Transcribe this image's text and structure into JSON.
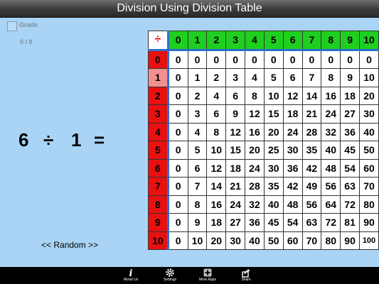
{
  "app": {
    "title": "Division Using Division Table"
  },
  "grade": {
    "label": "Grade",
    "score": "0 / 0"
  },
  "equation": {
    "dividend": "6",
    "operator": "÷",
    "divisor": "1",
    "equals": "="
  },
  "random": {
    "label": "<< Random >>"
  },
  "table": {
    "symbol": "÷",
    "headers": [
      "0",
      "1",
      "2",
      "3",
      "4",
      "5",
      "6",
      "7",
      "8",
      "9",
      "10"
    ],
    "selected_row": 1,
    "rows": [
      {
        "label": "0",
        "cells": [
          "0",
          "0",
          "0",
          "0",
          "0",
          "0",
          "0",
          "0",
          "0",
          "0",
          "0"
        ]
      },
      {
        "label": "1",
        "cells": [
          "0",
          "1",
          "2",
          "3",
          "4",
          "5",
          "6",
          "7",
          "8",
          "9",
          "10"
        ]
      },
      {
        "label": "2",
        "cells": [
          "0",
          "2",
          "4",
          "6",
          "8",
          "10",
          "12",
          "14",
          "16",
          "18",
          "20"
        ]
      },
      {
        "label": "3",
        "cells": [
          "0",
          "3",
          "6",
          "9",
          "12",
          "15",
          "18",
          "21",
          "24",
          "27",
          "30"
        ]
      },
      {
        "label": "4",
        "cells": [
          "0",
          "4",
          "8",
          "12",
          "16",
          "20",
          "24",
          "28",
          "32",
          "36",
          "40"
        ]
      },
      {
        "label": "5",
        "cells": [
          "0",
          "5",
          "10",
          "15",
          "20",
          "25",
          "30",
          "35",
          "40",
          "45",
          "50"
        ]
      },
      {
        "label": "6",
        "cells": [
          "0",
          "6",
          "12",
          "18",
          "24",
          "30",
          "36",
          "42",
          "48",
          "54",
          "60"
        ]
      },
      {
        "label": "7",
        "cells": [
          "0",
          "7",
          "14",
          "21",
          "28",
          "35",
          "42",
          "49",
          "56",
          "63",
          "70"
        ]
      },
      {
        "label": "8",
        "cells": [
          "0",
          "8",
          "16",
          "24",
          "32",
          "40",
          "48",
          "56",
          "64",
          "72",
          "80"
        ]
      },
      {
        "label": "9",
        "cells": [
          "0",
          "9",
          "18",
          "27",
          "36",
          "45",
          "54",
          "63",
          "72",
          "81",
          "90"
        ]
      },
      {
        "label": "10",
        "cells": [
          "0",
          "10",
          "20",
          "30",
          "40",
          "50",
          "60",
          "70",
          "80",
          "90",
          "100"
        ]
      }
    ]
  },
  "toolbar": {
    "items": [
      {
        "label": "About Us",
        "icon": "info-icon"
      },
      {
        "label": "Settings",
        "icon": "gear-icon"
      },
      {
        "label": "More Apps",
        "icon": "plus-icon"
      },
      {
        "label": "Share",
        "icon": "share-icon"
      }
    ]
  }
}
